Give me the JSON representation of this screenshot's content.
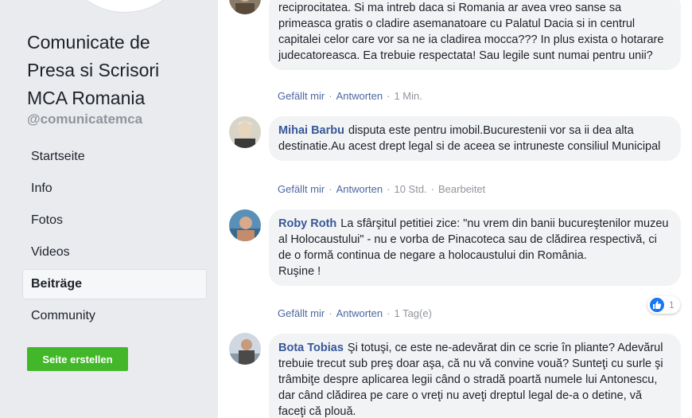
{
  "page": {
    "name": "Comunicate de Presa si Scrisori MCA Romania",
    "handle": "@comunicatemca"
  },
  "nav": {
    "items": [
      {
        "label": "Startseite"
      },
      {
        "label": "Info"
      },
      {
        "label": "Fotos"
      },
      {
        "label": "Videos"
      },
      {
        "label": "Beiträge",
        "active": true
      },
      {
        "label": "Community"
      }
    ],
    "create_page_label": "Seite erstellen"
  },
  "actions": {
    "like_label": "Gefällt mir",
    "reply_label": "Antworten",
    "edited_label": "Bearbeitet"
  },
  "comments": [
    {
      "author": "",
      "text": "reciprocitatea. Si ma intreb daca si Romania ar avea vreo sanse sa primeasca gratis o cladire asemanatoare cu Palatul Dacia si in centrul capitalei celor care vor sa ne ia cladirea mocca??? In plus exista o hotarare judecatoreasca. Ea trebuie respectata! Sau legile sunt numai pentru unii?",
      "time": "1 Min."
    },
    {
      "author": "Mihai Barbu",
      "text": "disputa este pentru imobil.Bucurestenii vor sa ii dea alta destinatie.Au acest drept legal si de aceea se intruneste consiliul Municipal",
      "time": "10 Std."
    },
    {
      "author": "Roby Roth",
      "text": "La sfârşitul petitiei zice: \"nu vrem din banii bucureştenilor muzeu al Holocaustului\" - nu e vorba de Pinacoteca sau de clădirea respectivă, ci de o formă continua de negare a holocaustului din România.",
      "text2": "Ruşine !",
      "time": "1 Tag(e)",
      "reaction_count": "1"
    },
    {
      "author": "Bota Tobias",
      "text": "Şi totuşi, ce este ne-adevărat din ce scrie în pliante? Adevărul trebuie trecut sub preş doar aşa, că nu vă convine vouă? Sunteţi cu surle şi trâmbiţe despre aplicarea legii când o stradă poartă numele lui Antonescu, dar când clădirea pe care o vreţi nu aveţi dreptul legal de-a o detine, vă faceţi că plouă."
    }
  ]
}
